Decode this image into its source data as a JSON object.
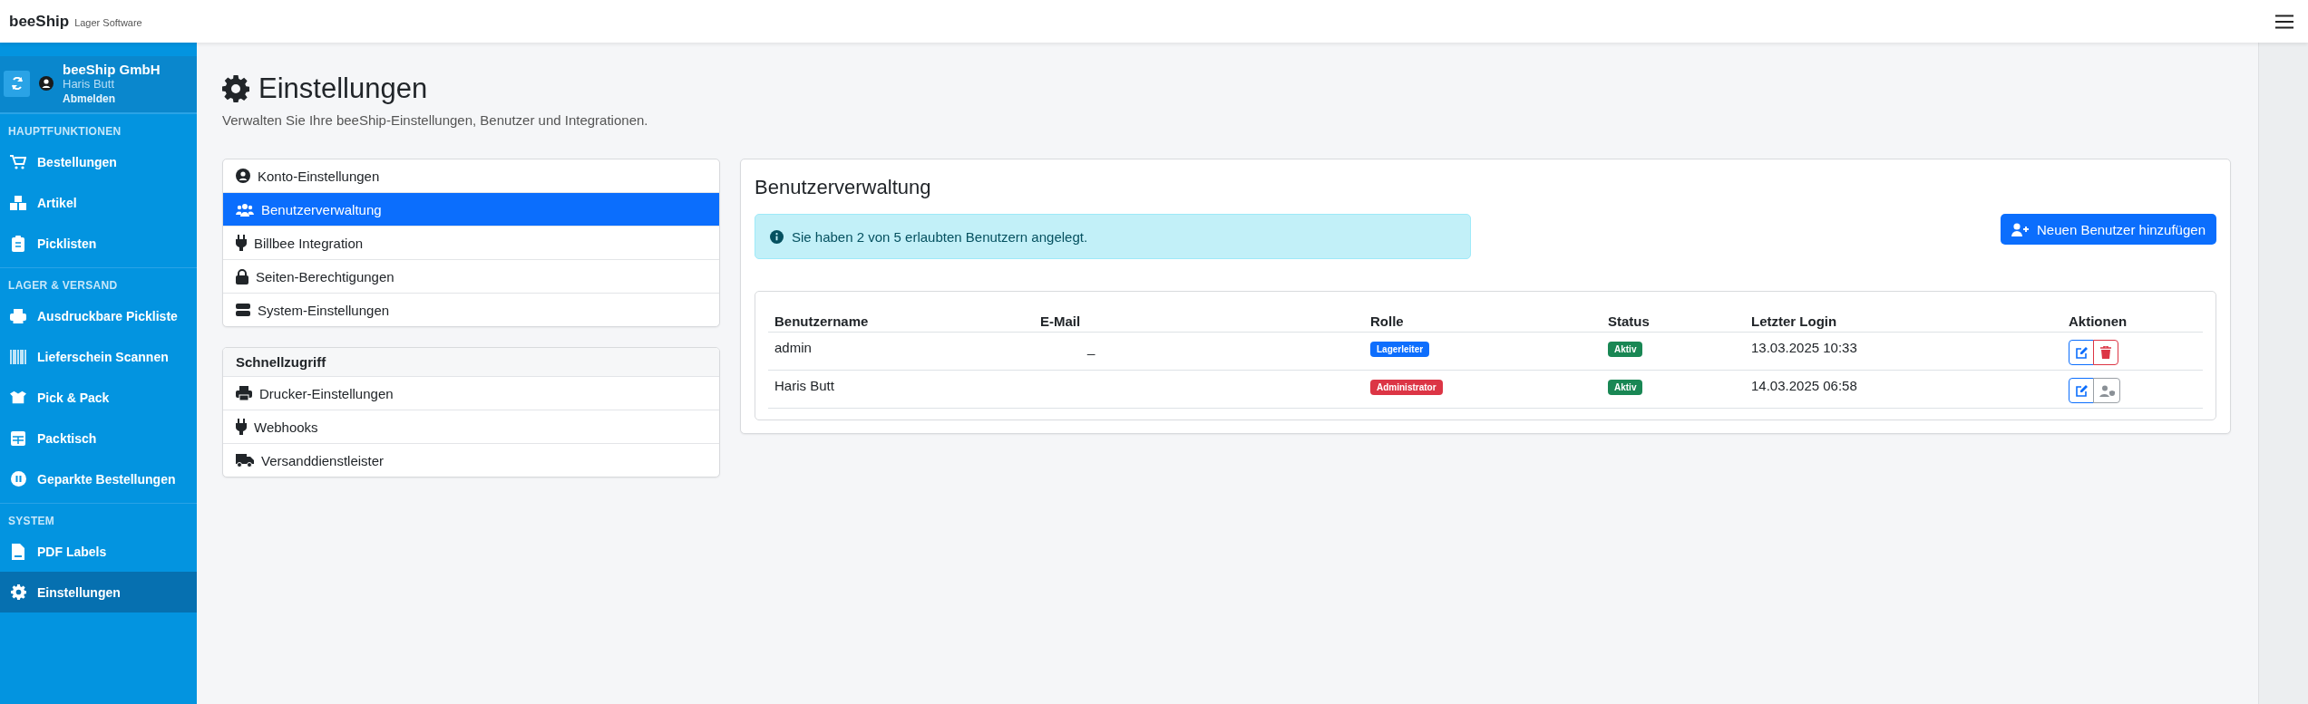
{
  "topbar": {
    "brand": "beeShip",
    "subtitle": "Lager Software"
  },
  "sidebar": {
    "company": "beeShip GmbH",
    "user": "Haris Butt",
    "logout": "Abmelden",
    "sections": [
      {
        "title": "HAUPTFUNKTIONEN",
        "items": [
          {
            "label": "Bestellungen",
            "selected": false
          },
          {
            "label": "Artikel",
            "selected": false
          },
          {
            "label": "Picklisten",
            "selected": false
          }
        ]
      },
      {
        "title": "LAGER & VERSAND",
        "items": [
          {
            "label": "Ausdruckbare Pickliste",
            "selected": false
          },
          {
            "label": "Lieferschein Scannen",
            "selected": false
          },
          {
            "label": "Pick & Pack",
            "selected": false
          },
          {
            "label": "Packtisch",
            "selected": false
          },
          {
            "label": "Geparkte Bestellungen",
            "selected": false
          }
        ]
      },
      {
        "title": "SYSTEM",
        "items": [
          {
            "label": "PDF Labels",
            "selected": false
          },
          {
            "label": "Einstellungen",
            "selected": true
          }
        ]
      }
    ]
  },
  "page": {
    "title": "Einstellungen",
    "subtitle": "Verwalten Sie Ihre beeShip-Einstellungen, Benutzer und Integrationen."
  },
  "settings_menu": [
    {
      "label": "Konto-Einstellungen",
      "selected": false
    },
    {
      "label": "Benutzerverwaltung",
      "selected": true
    },
    {
      "label": "Billbee Integration",
      "selected": false
    },
    {
      "label": "Seiten-Berechtigungen",
      "selected": false
    },
    {
      "label": "System-Einstellungen",
      "selected": false
    }
  ],
  "quick_access": {
    "title": "Schnellzugriff",
    "items": [
      "Drucker-Einstellungen",
      "Webhooks",
      "Versanddienstleister"
    ]
  },
  "users_panel": {
    "title": "Benutzerverwaltung",
    "alert": "Sie haben 2 von 5 erlaubten Benutzern angelegt.",
    "add_button": "Neuen Benutzer hinzufügen",
    "table": {
      "columns": [
        "Benutzername",
        "E-Mail",
        "Rolle",
        "Status",
        "Letzter Login",
        "Aktionen"
      ],
      "rows": [
        {
          "username": "admin",
          "email": "_",
          "role": {
            "label": "Lagerleiter",
            "color": "#0d6efd"
          },
          "status": {
            "label": "Aktiv",
            "color": "#198754"
          },
          "last_login": "13.03.2025 10:33",
          "actions": [
            {
              "kind": "edit"
            },
            {
              "kind": "delete"
            }
          ]
        },
        {
          "username": "Haris Butt",
          "role": {
            "label": "Administrator",
            "color": "#dc3545"
          },
          "status": {
            "label": "Aktiv",
            "color": "#198754"
          },
          "last_login": "14.03.2025 06:58",
          "actions": [
            {
              "kind": "edit"
            },
            {
              "kind": "role-locked"
            }
          ]
        }
      ]
    }
  }
}
